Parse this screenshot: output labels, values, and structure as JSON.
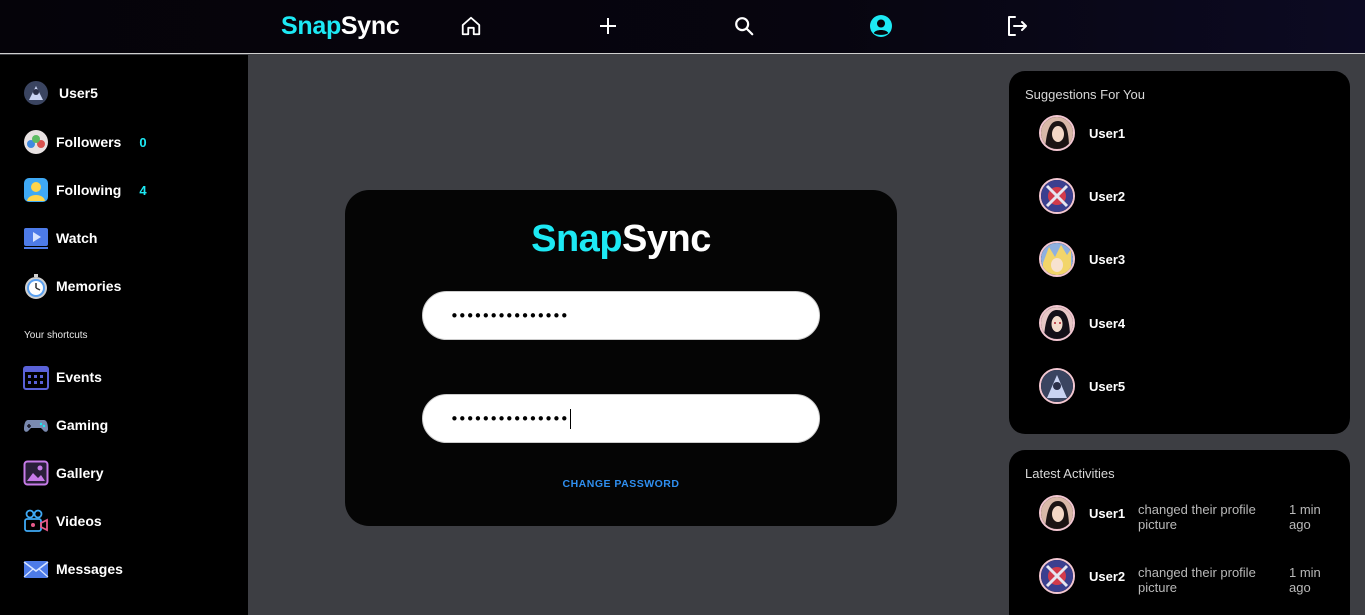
{
  "brand": {
    "part1": "Snap",
    "part2": "Sync"
  },
  "nav": {
    "icons": [
      "home-icon",
      "plus-icon",
      "search-icon",
      "profile-icon",
      "logout-icon"
    ],
    "active": "profile-icon"
  },
  "sidebar": {
    "profile": {
      "label": "User5"
    },
    "followers": {
      "label": "Followers",
      "count": "0"
    },
    "following": {
      "label": "Following",
      "count": "4"
    },
    "watch": {
      "label": "Watch"
    },
    "memories": {
      "label": "Memories"
    },
    "shortcuts_heading": "Your shortcuts",
    "events": {
      "label": "Events"
    },
    "gaming": {
      "label": "Gaming"
    },
    "gallery": {
      "label": "Gallery"
    },
    "videos": {
      "label": "Videos"
    },
    "messages": {
      "label": "Messages"
    }
  },
  "form": {
    "brand_part1": "Snap",
    "brand_part2": "Sync",
    "field1_value": "•••••••••••••••",
    "field2_value": "•••••••••••••••",
    "submit_label": "CHANGE PASSWORD"
  },
  "suggestions": {
    "title": "Suggestions For You",
    "users": [
      {
        "name": "User1"
      },
      {
        "name": "User2"
      },
      {
        "name": "User3"
      },
      {
        "name": "User4"
      },
      {
        "name": "User5"
      }
    ]
  },
  "activities": {
    "title": "Latest Activities",
    "items": [
      {
        "user": "User1",
        "text": "changed their profile picture",
        "time": "1 min ago"
      },
      {
        "user": "User2",
        "text": "changed their profile picture",
        "time": "1 min ago"
      }
    ]
  },
  "colors": {
    "accent": "#1de9f4",
    "link": "#2f8ff0",
    "background": "#3d3e43"
  }
}
